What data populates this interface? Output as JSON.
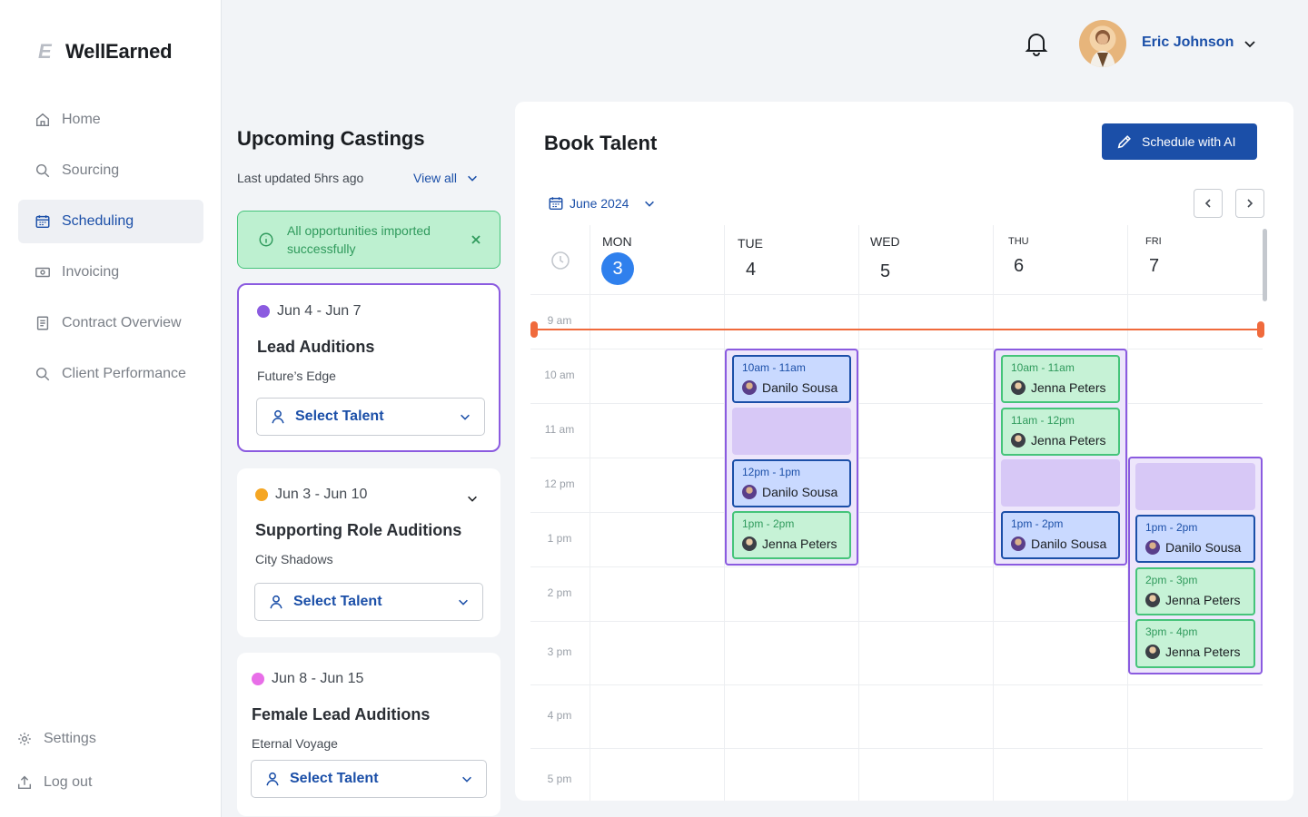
{
  "app": {
    "name": "WellEarned",
    "logo_glyph": "E"
  },
  "sidebar": {
    "items": [
      {
        "label": "Home"
      },
      {
        "label": "Sourcing"
      },
      {
        "label": "Scheduling"
      },
      {
        "label": "Invoicing"
      },
      {
        "label": "Contract Overview"
      },
      {
        "label": "Client Performance"
      }
    ],
    "settings": "Settings",
    "logout": "Log out"
  },
  "header": {
    "user_name": "Eric Johnson"
  },
  "castings": {
    "title": "Upcoming Castings",
    "updated": "Last updated 5hrs ago",
    "view_all": "View all",
    "toast": "All opportunities imported successfully",
    "cards": [
      {
        "dates": "Jun 4 - Jun 7",
        "role": "Lead Auditions",
        "project": "Future’s Edge",
        "dot": "#8b5be0",
        "select": "Select Talent"
      },
      {
        "dates": "Jun 3 - Jun 10",
        "role": "Supporting Role Auditions",
        "project": "City Shadows",
        "dot": "#f5a623",
        "select": "Select Talent"
      },
      {
        "dates": "Jun 8 - Jun 15",
        "role": "Female Lead Auditions",
        "project": "Eternal Voyage",
        "dot": "#e86ee8",
        "select": "Select Talent"
      }
    ]
  },
  "calendar": {
    "title": "Book Talent",
    "ai_button": "Schedule with AI",
    "month": "June 2024",
    "days": [
      {
        "name": "MON",
        "num": "3"
      },
      {
        "name": "TUE",
        "num": "4"
      },
      {
        "name": "WED",
        "num": "5"
      },
      {
        "name": "THU",
        "num": "6"
      },
      {
        "name": "FRI",
        "num": "7"
      }
    ],
    "hours": [
      "9 am",
      "10 am",
      "11 am",
      "12 pm",
      "1 pm",
      "2 pm",
      "3 pm",
      "4 pm",
      "5 pm"
    ],
    "slots": {
      "tue": [
        {
          "time": "10am - 11am",
          "person": "Danilo Sousa"
        },
        {
          "time": "12pm - 1pm",
          "person": "Danilo Sousa"
        },
        {
          "time": "1pm - 2pm",
          "person": "Jenna Peters"
        }
      ],
      "thu": [
        {
          "time": "10am - 11am",
          "person": "Jenna Peters"
        },
        {
          "time": "11am - 12pm",
          "person": "Jenna Peters"
        },
        {
          "time": "1pm - 2pm",
          "person": "Danilo Sousa"
        }
      ],
      "fri": [
        {
          "time": "1pm - 2pm",
          "person": "Danilo Sousa"
        },
        {
          "time": "2pm - 3pm",
          "person": "Jenna Peters"
        },
        {
          "time": "3pm - 4pm",
          "person": "Jenna Peters"
        }
      ]
    }
  },
  "colors": {
    "accent": "#1b4fa8",
    "today": "#2f80ed",
    "now_line": "#f06a3c",
    "group": "#8b5be0"
  }
}
